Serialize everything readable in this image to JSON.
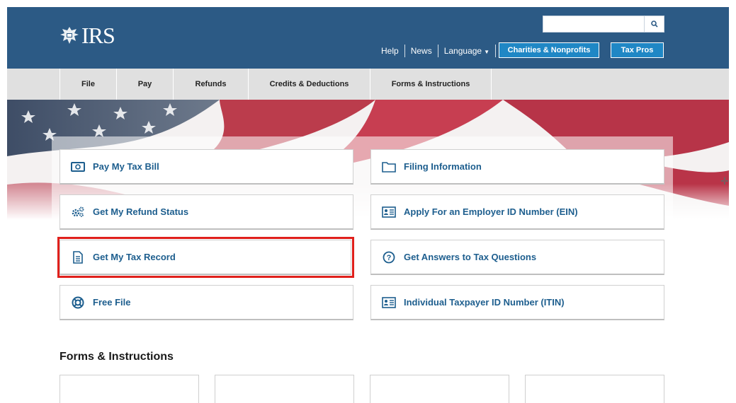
{
  "header": {
    "logo_text": "IRS",
    "utility": {
      "help": "Help",
      "news": "News",
      "language": "Language"
    },
    "buttons": {
      "charities": "Charities & Nonprofits",
      "taxpros": "Tax Pros"
    },
    "search": {
      "value": ""
    }
  },
  "nav": {
    "items": [
      "File",
      "Pay",
      "Refunds",
      "Credits & Deductions",
      "Forms & Instructions"
    ]
  },
  "cards": {
    "left": [
      "Pay My Tax Bill",
      "Get My Refund Status",
      "Get My Tax Record",
      "Free File"
    ],
    "right": [
      "Filing Information",
      "Apply For an Employer ID Number (EIN)",
      "Get Answers to Tax Questions",
      "Individual Taxpayer ID Number (ITIN)"
    ],
    "icons_left": [
      "bill-icon",
      "gears-icon",
      "document-icon",
      "lifebuoy-icon"
    ],
    "icons_right": [
      "folder-icon",
      "id-card-icon",
      "question-icon",
      "id-card-icon"
    ]
  },
  "sections": {
    "forms_title": "Forms & Instructions"
  },
  "colors": {
    "header_bg": "#2c5a85",
    "link": "#1d5e8e",
    "highlight": "#e0201c",
    "button_blue": "#1f87c5"
  }
}
